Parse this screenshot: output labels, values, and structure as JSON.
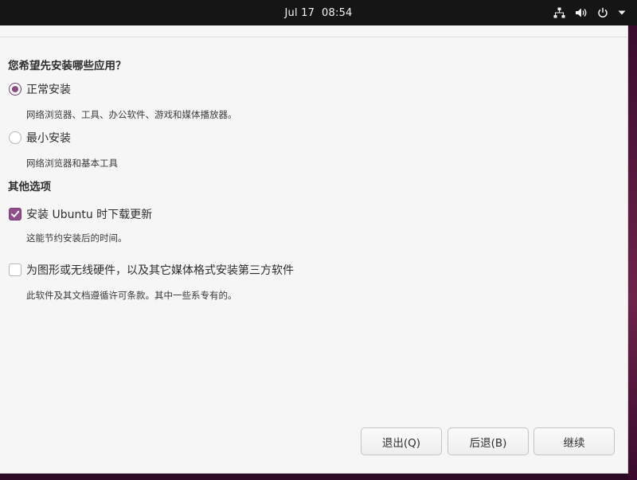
{
  "topbar": {
    "date": "Jul 17",
    "time": "08:54",
    "icons": [
      "network-icon",
      "volume-icon",
      "power-icon",
      "menu-arrow-icon"
    ]
  },
  "installer": {
    "apps_heading": "您希望先安装哪些应用？",
    "normal": {
      "label": "正常安装",
      "desc": "网络浏览器、工具、办公软件、游戏和媒体播放器。",
      "selected": true
    },
    "minimal": {
      "label": "最小安装",
      "desc": "网络浏览器和基本工具",
      "selected": false
    },
    "other_heading": "其他选项",
    "updates": {
      "label": "安装 Ubuntu 时下载更新",
      "desc": "这能节约安装后的时间。",
      "checked": true
    },
    "third_party": {
      "label": "为图形或无线硬件，以及其它媒体格式安装第三方软件",
      "desc": "此软件及其文档遵循许可条款。其中一些系专有的。",
      "checked": false
    },
    "buttons": {
      "quit": "退出(Q)",
      "back": "后退(B)",
      "continue": "继续"
    }
  },
  "colors": {
    "accent": "#924d8b",
    "topbar": "#151515",
    "window_bg": "#f6f6f6"
  }
}
